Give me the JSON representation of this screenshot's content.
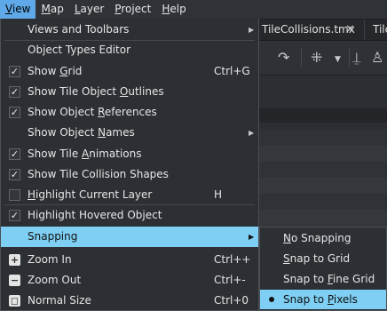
{
  "menubar": [
    {
      "label": "View",
      "u": "V",
      "rest": "iew",
      "active": true
    },
    {
      "label": "Map",
      "u": "M",
      "rest": "ap",
      "active": false
    },
    {
      "label": "Layer",
      "u": "L",
      "rest": "ayer",
      "active": false
    },
    {
      "label": "Project",
      "u": "P",
      "rest": "roject",
      "active": false
    },
    {
      "label": "Help",
      "u": "H",
      "rest": "elp",
      "active": false
    }
  ],
  "tabs": [
    {
      "label": "TileCollisions.tmx",
      "close": "✕"
    },
    {
      "label": "Tile",
      "close": ""
    }
  ],
  "toolbar": {
    "redo_icon": "redo-icon",
    "select_icon": "select-objects-icon",
    "dropdown_icon": "chevron-down-icon",
    "tool_icon": "stamp-icon",
    "person_icon": "person-icon"
  },
  "view_menu": {
    "items": [
      {
        "label": "Views and Toolbars",
        "pre": "Views and Toolbars",
        "u": "",
        "post": "",
        "check": "none",
        "shortcut": "",
        "submenu": true
      },
      {
        "label": "Object Types Editor",
        "pre": "Object Types Editor",
        "u": "",
        "post": "",
        "check": "none",
        "shortcut": "",
        "submenu": false
      },
      {
        "label": "Show Grid",
        "pre": "Show ",
        "u": "G",
        "post": "rid",
        "check": "checked",
        "shortcut": "Ctrl+G",
        "submenu": false
      },
      {
        "label": "Show Tile Object Outlines",
        "pre": "Show Tile Object ",
        "u": "O",
        "post": "utlines",
        "check": "checked",
        "shortcut": "",
        "submenu": false
      },
      {
        "label": "Show Object References",
        "pre": "Show Object ",
        "u": "R",
        "post": "eferences",
        "check": "checked",
        "shortcut": "",
        "submenu": false
      },
      {
        "label": "Show Object Names",
        "pre": "Show Object ",
        "u": "N",
        "post": "ames",
        "check": "none",
        "shortcut": "",
        "submenu": true
      },
      {
        "label": "Show Tile Animations",
        "pre": "Show Tile ",
        "u": "A",
        "post": "nimations",
        "check": "checked",
        "shortcut": "",
        "submenu": false
      },
      {
        "label": "Show Tile Collision Shapes",
        "pre": "Show Tile Collision Shapes",
        "u": "",
        "post": "",
        "check": "checked",
        "shortcut": "",
        "submenu": false
      },
      {
        "label": "Highlight Current Layer",
        "pre": "",
        "u": "H",
        "post": "ighlight Current Layer",
        "check": "unchecked",
        "shortcut": "H",
        "submenu": false
      },
      {
        "label": "Highlight Hovered Object",
        "pre": "Highlight Hovered Object",
        "u": "",
        "post": "",
        "check": "checked",
        "shortcut": "",
        "submenu": false
      },
      {
        "label": "Snapping",
        "pre": "Snapping",
        "u": "",
        "post": "",
        "check": "none",
        "shortcut": "",
        "submenu": true,
        "highlight": true
      },
      {
        "label": "Zoom In",
        "pre": "Zoom In",
        "u": "",
        "post": "",
        "check": "icon",
        "icon": "zoom-in-icon",
        "glyph": "+",
        "shortcut": "Ctrl++",
        "submenu": false
      },
      {
        "label": "Zoom Out",
        "pre": "Zoom Out",
        "u": "",
        "post": "",
        "check": "icon",
        "icon": "zoom-out-icon",
        "glyph": "−",
        "shortcut": "Ctrl+-",
        "submenu": false
      },
      {
        "label": "Normal Size",
        "pre": "Normal Size",
        "u": "",
        "post": "",
        "check": "icon",
        "icon": "normal-size-icon",
        "glyph": "◻",
        "shortcut": "Ctrl+0",
        "submenu": false
      }
    ]
  },
  "snapping_menu": {
    "items": [
      {
        "label": "No Snapping",
        "pre": "",
        "u": "N",
        "post": "o Snapping",
        "selected": false
      },
      {
        "label": "Snap to Grid",
        "pre": "",
        "u": "S",
        "post": "nap to Grid",
        "selected": false
      },
      {
        "label": "Snap to Fine Grid",
        "pre": "Snap to ",
        "u": "F",
        "post": "ine Grid",
        "selected": false
      },
      {
        "label": "Snap to Pixels",
        "pre": "Snap to ",
        "u": "P",
        "post": "ixels",
        "selected": true
      }
    ]
  },
  "colors": {
    "menu_bg": "#2c2f33",
    "highlight": "#7ecff3",
    "menubar_active": "#5fa9e8"
  }
}
